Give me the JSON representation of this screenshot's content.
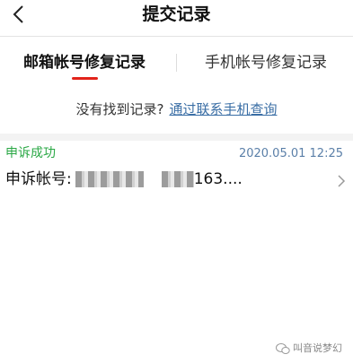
{
  "header": {
    "title": "提交记录",
    "back_icon": "back-arrow-icon"
  },
  "tabs": [
    {
      "label": "邮箱帐号修复记录",
      "active": true
    },
    {
      "label": "手机帐号修复记录",
      "active": false
    }
  ],
  "hint": {
    "text": "没有找到记录?",
    "link": "通过联系手机查询"
  },
  "record": {
    "status": "申诉成功",
    "time": "2020.05.01 12:25",
    "account_label": "申诉帐号:",
    "account_suffix": "163...."
  },
  "watermark": {
    "text": "叫音说梦幻"
  },
  "colors": {
    "accent_red": "#e2231a",
    "success_green": "#2aa845",
    "link_blue": "#3a6ea5",
    "time_blue": "#5a7fa8"
  }
}
